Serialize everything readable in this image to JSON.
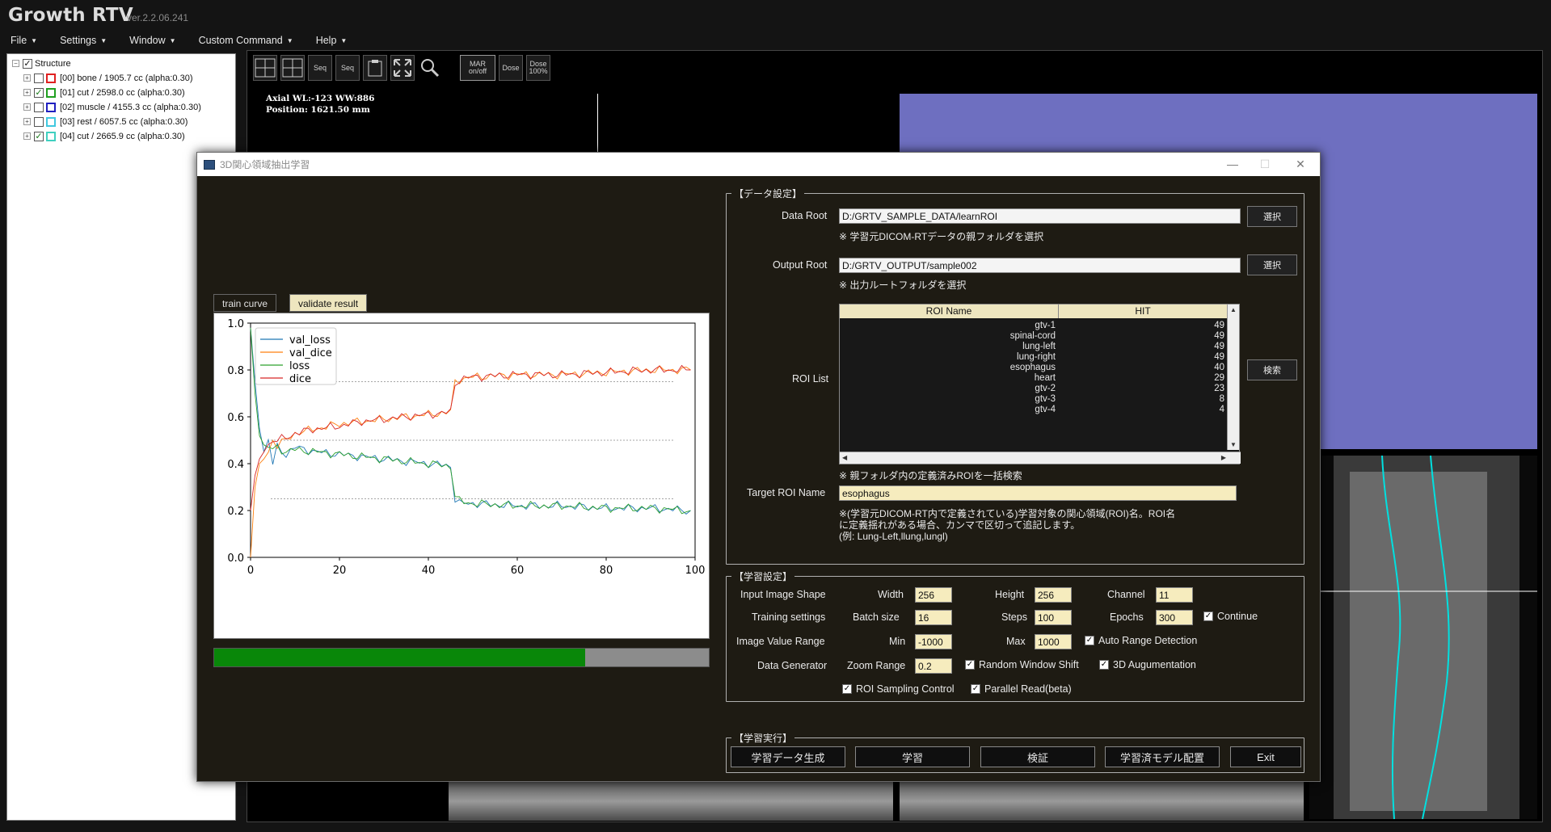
{
  "app": {
    "title": "Growth RTV",
    "version": "ver.2.2.06.241"
  },
  "menu": [
    {
      "label": "File"
    },
    {
      "label": "Settings"
    },
    {
      "label": "Window"
    },
    {
      "label": "Custom Command"
    },
    {
      "label": "Help"
    }
  ],
  "tree": {
    "root": "Structure",
    "items": [
      {
        "label": "[00] bone / 1905.7 cc (alpha:0.30)",
        "color": "#e02020",
        "checked": false
      },
      {
        "label": "[01] cut / 2598.0 cc (alpha:0.30)",
        "color": "#20a020",
        "checked": true
      },
      {
        "label": "[02] muscle / 4155.3 cc (alpha:0.30)",
        "color": "#2020c0",
        "checked": false
      },
      {
        "label": "[03] rest / 6057.5 cc (alpha:0.30)",
        "color": "#40c8e0",
        "checked": false
      },
      {
        "label": "[04] cut / 2665.9 cc (alpha:0.30)",
        "color": "#40d0c0",
        "checked": true
      }
    ]
  },
  "toolbar": {
    "seq1": "Seq",
    "seq2": "Seq",
    "mar": "MAR on/off",
    "dose1": "Dose",
    "dose2": "Dose 100%"
  },
  "viewer": {
    "axial_line1": "Axial WL:-123 WW:886",
    "axial_line2": "Position: 1621.50 mm"
  },
  "dialog": {
    "title": "3D関心領域抽出学習",
    "tabs": {
      "train": "train curve",
      "validate": "validate result"
    },
    "progress": 0.75,
    "data_group": {
      "title": "【データ設定】",
      "data_root_label": "Data Root",
      "data_root_value": "D:/GRTV_SAMPLE_DATA/learnROI",
      "data_root_note": "※ 学習元DICOM-RTデータの親フォルダを選択",
      "output_root_label": "Output Root",
      "output_root_value": "D:/GRTV_OUTPUT/sample002",
      "output_root_note": "※ 出力ルートフォルダを選択",
      "select_button": "選択",
      "roi_list_label": "ROI List",
      "search_button": "検索",
      "roi_columns": [
        "ROI Name",
        "HIT"
      ],
      "roi_rows": [
        {
          "name": "gtv-1",
          "hit": "49"
        },
        {
          "name": "spinal-cord",
          "hit": "49"
        },
        {
          "name": "lung-left",
          "hit": "49"
        },
        {
          "name": "lung-right",
          "hit": "49"
        },
        {
          "name": "esophagus",
          "hit": "40"
        },
        {
          "name": "heart",
          "hit": "29"
        },
        {
          "name": "gtv-2",
          "hit": "23"
        },
        {
          "name": "gtv-3",
          "hit": "8"
        },
        {
          "name": "gtv-4",
          "hit": "4"
        }
      ],
      "roi_note": "※ 親フォルダ内の定義済みROIを一括検索",
      "target_label": "Target ROI Name",
      "target_value": "esophagus",
      "target_note1": "※(学習元DICOM-RT内で定義されている)学習対象の関心領域(ROI)名。ROI名",
      "target_note2": "に定義揺れがある場合、カンマで区切って追記します。",
      "target_note3": "(例: Lung-Left,llung,lungl)"
    },
    "train_group": {
      "title": "【学習設定】",
      "input_shape_label": "Input Image Shape",
      "width_label": "Width",
      "width_value": "256",
      "height_label": "Height",
      "height_value": "256",
      "channel_label": "Channel",
      "channel_value": "11",
      "training_label": "Training settings",
      "batch_label": "Batch size",
      "batch_value": "16",
      "steps_label": "Steps",
      "steps_value": "100",
      "epochs_label": "Epochs",
      "epochs_value": "300",
      "continue_label": "Continue",
      "range_label": "Image Value Range",
      "min_label": "Min",
      "min_value": "-1000",
      "max_label": "Max",
      "max_value": "1000",
      "auto_range_label": "Auto Range Detection",
      "generator_label": "Data Generator",
      "zoom_label": "Zoom Range",
      "zoom_value": "0.2",
      "random_shift_label": "Random Window Shift",
      "aug_label": "3D Augumentation",
      "roi_sampling_label": "ROI Sampling Control",
      "parallel_label": "Parallel Read(beta)"
    },
    "run_group": {
      "title": "【学習実行】",
      "buttons": [
        "学習データ生成",
        "学習",
        "検証",
        "学習済モデル配置",
        "Exit"
      ]
    }
  },
  "chart_data": {
    "type": "line",
    "xlim": [
      0,
      100
    ],
    "ylim": [
      0.0,
      1.0
    ],
    "xticks": [
      "0",
      "20",
      "40",
      "60",
      "80",
      "100"
    ],
    "yticks": [
      "0.0",
      "0.2",
      "0.4",
      "0.6",
      "0.8",
      "1.0"
    ],
    "legend_position": "top-left",
    "reference_lines": [
      0.25,
      0.5,
      0.75
    ],
    "series": [
      {
        "name": "val_loss",
        "color": "#1f77b4",
        "x": [
          0,
          1,
          2,
          3,
          4,
          5,
          6,
          8,
          10,
          15,
          20,
          25,
          30,
          35,
          40,
          45,
          46,
          47,
          50,
          60,
          70,
          80,
          90,
          99
        ],
        "y": [
          0.98,
          0.75,
          0.55,
          0.45,
          0.5,
          0.4,
          0.47,
          0.44,
          0.47,
          0.45,
          0.44,
          0.43,
          0.42,
          0.41,
          0.4,
          0.39,
          0.25,
          0.23,
          0.23,
          0.22,
          0.22,
          0.21,
          0.21,
          0.2
        ]
      },
      {
        "name": "val_dice",
        "color": "#ff7f0e",
        "x": [
          0,
          1,
          2,
          3,
          4,
          5,
          6,
          8,
          10,
          15,
          20,
          25,
          30,
          35,
          40,
          45,
          46,
          47,
          50,
          60,
          70,
          80,
          90,
          99
        ],
        "y": [
          0.0,
          0.3,
          0.4,
          0.42,
          0.45,
          0.5,
          0.48,
          0.5,
          0.53,
          0.55,
          0.57,
          0.58,
          0.59,
          0.6,
          0.61,
          0.62,
          0.75,
          0.76,
          0.77,
          0.78,
          0.78,
          0.79,
          0.8,
          0.8
        ]
      },
      {
        "name": "loss",
        "color": "#2ca02c",
        "x": [
          0,
          1,
          2,
          3,
          4,
          5,
          6,
          8,
          10,
          15,
          20,
          25,
          30,
          35,
          40,
          45,
          46,
          47,
          50,
          60,
          70,
          80,
          90,
          99
        ],
        "y": [
          0.98,
          0.7,
          0.52,
          0.48,
          0.47,
          0.46,
          0.47,
          0.45,
          0.46,
          0.45,
          0.44,
          0.43,
          0.42,
          0.41,
          0.4,
          0.39,
          0.26,
          0.24,
          0.23,
          0.22,
          0.22,
          0.21,
          0.21,
          0.2
        ]
      },
      {
        "name": "dice",
        "color": "#d62728",
        "x": [
          0,
          1,
          2,
          3,
          4,
          5,
          6,
          8,
          10,
          15,
          20,
          25,
          30,
          35,
          40,
          45,
          46,
          47,
          50,
          60,
          70,
          80,
          90,
          99
        ],
        "y": [
          0.2,
          0.35,
          0.42,
          0.45,
          0.48,
          0.5,
          0.5,
          0.51,
          0.53,
          0.55,
          0.56,
          0.58,
          0.59,
          0.6,
          0.61,
          0.62,
          0.74,
          0.76,
          0.77,
          0.78,
          0.78,
          0.79,
          0.8,
          0.8
        ]
      }
    ]
  }
}
